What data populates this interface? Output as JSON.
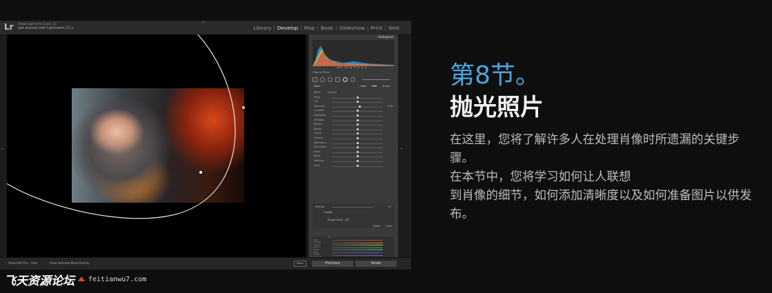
{
  "lightroom": {
    "logo": "Lr",
    "app_name": "Adobe Lightroom Classic CC",
    "catalog": "Get started with Lightroom CC ▸",
    "modules": [
      "Library",
      "Develop",
      "Map",
      "Book",
      "Slideshow",
      "Print",
      "Web"
    ],
    "active_module": "Develop",
    "panel": {
      "histogram_label": "Histogram",
      "histogram_readout": "ISO  15.8    5.8    5.4",
      "original_photo": "Original Photo",
      "mask_label": "Mask :",
      "mask_new": "New",
      "mask_edit": "Edit",
      "mask_brush": "Brush",
      "effect_label": "Effect :",
      "effect_value": "Custom",
      "sliders": [
        {
          "label": "Temp",
          "value": "",
          "pos": 0.5
        },
        {
          "label": "Tint",
          "value": "",
          "pos": 0.5
        },
        {
          "label": "Exposure",
          "value": "0.28",
          "pos": 0.55
        },
        {
          "label": "Contrast",
          "value": "",
          "pos": 0.5
        },
        {
          "label": "Highlights",
          "value": "",
          "pos": 0.5
        },
        {
          "label": "Shadows",
          "value": "",
          "pos": 0.5
        },
        {
          "label": "Whites",
          "value": "",
          "pos": 0.5
        },
        {
          "label": "Blacks",
          "value": "",
          "pos": 0.5
        },
        {
          "label": "Clarity",
          "value": "",
          "pos": 0.5
        },
        {
          "label": "Dehaze",
          "value": "",
          "pos": 0.5
        },
        {
          "label": "Saturation",
          "value": "",
          "pos": 0.5
        },
        {
          "label": "Sharpness",
          "value": "",
          "pos": 0.5
        },
        {
          "label": "Noise",
          "value": "",
          "pos": 0.5
        },
        {
          "label": "Moiré",
          "value": "",
          "pos": 0.5
        },
        {
          "label": "Defringe",
          "value": "",
          "pos": 0.5
        },
        {
          "label": "Color",
          "value": "",
          "pos": 0.5
        }
      ],
      "feather_label": "Feather",
      "feather_value": "50",
      "invert_label": "✓ Invert",
      "range_mask_label": "Range Mask : Off",
      "reset_small": "Reset",
      "close_small": "Close",
      "hsl_label": "Hue",
      "hsl_rows": [
        "Red",
        "Orange",
        "Yellow",
        "Green",
        "Aqua",
        "Blue",
        "Purple",
        "Magenta"
      ]
    },
    "bottom": {
      "show_edit_pins": "Show Edit Pins :  Auto",
      "show_overlay": "Show Selected Mask Overlay",
      "done": "Done",
      "previous": "Previous",
      "reset": "Reset"
    }
  },
  "section": {
    "number": "第8节。",
    "title": "抛光照片",
    "body": [
      "在这里，您将了解许多人在处理肖像时所遗漏的关键步骤。",
      "在本节中，您将学习如何让人联想",
      "到肖像的细节，如何添加清晰度以及如何准备图片以供发布。"
    ]
  },
  "watermark": {
    "cn": "飞天资源论坛",
    "url": "feitianwu7.com"
  },
  "colors": {
    "accent": "#4aa8de",
    "title": "#f2f2f2",
    "body": "#bdbdbd",
    "background": "#0e0e0e"
  }
}
